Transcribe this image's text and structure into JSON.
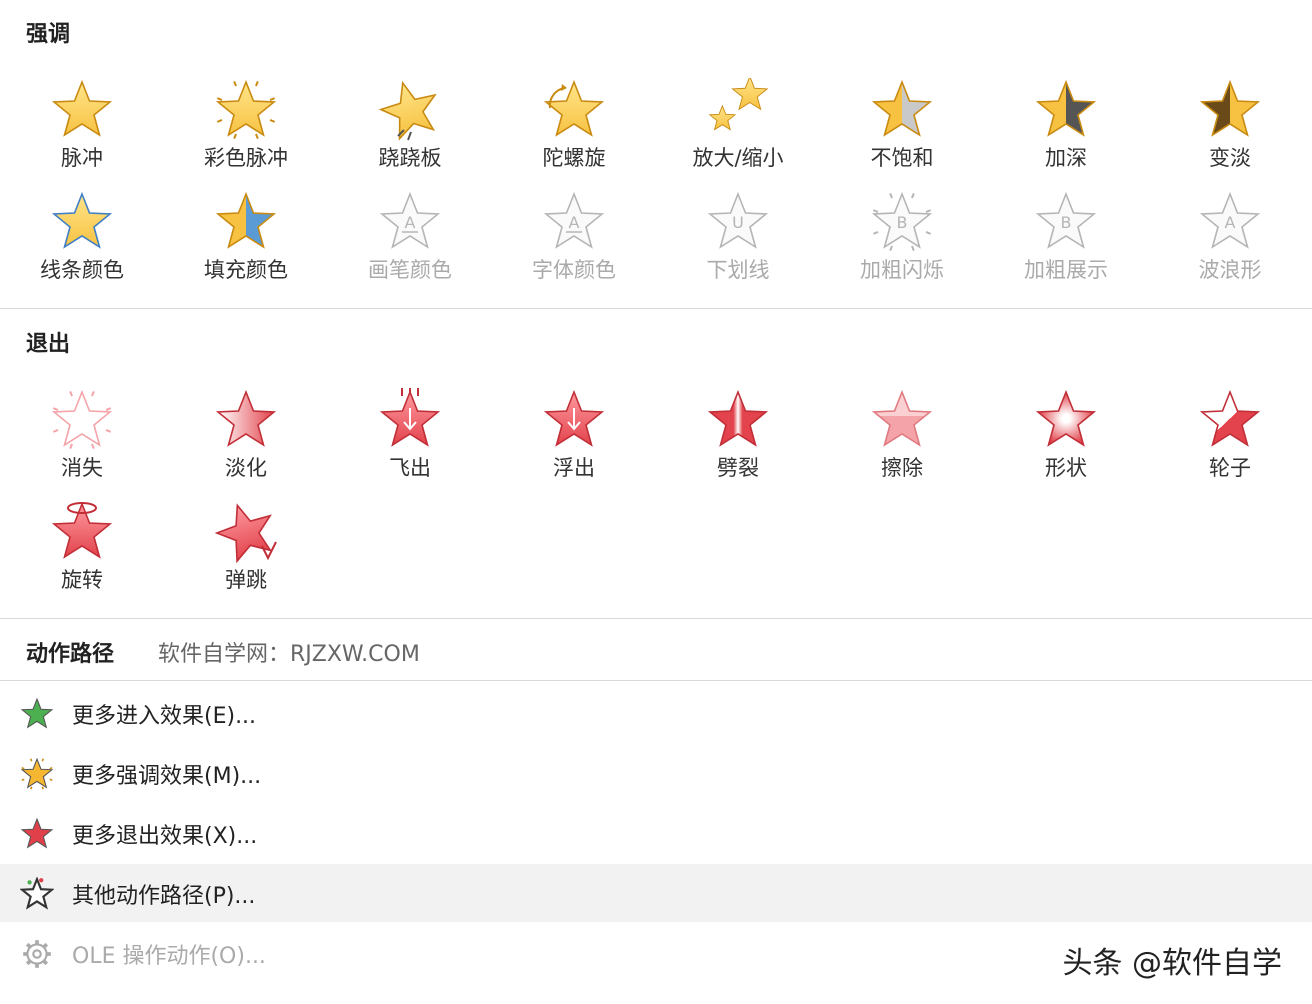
{
  "emphasis": {
    "title": "强调",
    "rows": [
      [
        {
          "label": "脉冲",
          "icon": "pulse-star-icon",
          "style": "gold",
          "disabled": false
        },
        {
          "label": "彩色脉冲",
          "icon": "color-pulse-star-icon",
          "style": "gold-burst",
          "disabled": false
        },
        {
          "label": "跷跷板",
          "icon": "teeter-star-icon",
          "style": "gold-tilt",
          "disabled": false
        },
        {
          "label": "陀螺旋",
          "icon": "spin-star-icon",
          "style": "gold-spin",
          "disabled": false
        },
        {
          "label": "放大/缩小",
          "icon": "grow-shrink-star-icon",
          "style": "gold-double",
          "disabled": false
        },
        {
          "label": "不饱和",
          "icon": "desaturate-star-icon",
          "style": "gold-gray",
          "disabled": false
        },
        {
          "label": "加深",
          "icon": "darken-star-icon",
          "style": "gold-dark",
          "disabled": false
        },
        {
          "label": "变淡",
          "icon": "lighten-star-icon",
          "style": "gold-brown",
          "disabled": false
        }
      ],
      [
        {
          "label": "线条颜色",
          "icon": "line-color-star-icon",
          "style": "gold-blueline",
          "disabled": false
        },
        {
          "label": "填充颜色",
          "icon": "fill-color-star-icon",
          "style": "gold-bluefill",
          "disabled": false
        },
        {
          "label": "画笔颜色",
          "icon": "brush-color-star-icon",
          "style": "outline-A",
          "disabled": true
        },
        {
          "label": "字体颜色",
          "icon": "font-color-star-icon",
          "style": "outline-A",
          "disabled": true
        },
        {
          "label": "下划线",
          "icon": "underline-star-icon",
          "style": "outline-U",
          "disabled": true
        },
        {
          "label": "加粗闪烁",
          "icon": "bold-flash-star-icon",
          "style": "outline-B-burst",
          "disabled": true
        },
        {
          "label": "加粗展示",
          "icon": "bold-reveal-star-icon",
          "style": "outline-B",
          "disabled": true
        },
        {
          "label": "波浪形",
          "icon": "wave-star-icon",
          "style": "outline-A-wave",
          "disabled": true
        }
      ]
    ]
  },
  "exit": {
    "title": "退出",
    "rows": [
      [
        {
          "label": "消失",
          "icon": "disappear-star-icon",
          "style": "red-outline-burst",
          "disabled": false
        },
        {
          "label": "淡化",
          "icon": "fade-star-icon",
          "style": "red-fade",
          "disabled": false
        },
        {
          "label": "飞出",
          "icon": "fly-out-star-icon",
          "style": "red-arrow-lines",
          "disabled": false
        },
        {
          "label": "浮出",
          "icon": "float-out-star-icon",
          "style": "red-arrow",
          "disabled": false
        },
        {
          "label": "劈裂",
          "icon": "split-star-icon",
          "style": "red-split",
          "disabled": false
        },
        {
          "label": "擦除",
          "icon": "wipe-star-icon",
          "style": "red-wipe",
          "disabled": false
        },
        {
          "label": "形状",
          "icon": "shape-star-icon",
          "style": "red-glow",
          "disabled": false
        },
        {
          "label": "轮子",
          "icon": "wheel-star-icon",
          "style": "red-wheel",
          "disabled": false
        }
      ],
      [
        {
          "label": "旋转",
          "icon": "rotate-star-icon",
          "style": "red-rotate",
          "disabled": false
        },
        {
          "label": "弹跳",
          "icon": "bounce-star-icon",
          "style": "red-bounce",
          "disabled": false
        }
      ]
    ]
  },
  "motion_path": {
    "title": "动作路径",
    "note": "软件自学网：RJZXW.COM"
  },
  "menu": [
    {
      "label": "更多进入效果(E)...",
      "icon": "green-star-icon",
      "color": "#4caf50",
      "disabled": false,
      "hover": false
    },
    {
      "label": "更多强调效果(M)...",
      "icon": "gold-burst-star-icon",
      "color": "#f5b731",
      "disabled": false,
      "hover": false
    },
    {
      "label": "更多退出效果(X)...",
      "icon": "red-star-icon",
      "color": "#e0404a",
      "disabled": false,
      "hover": false
    },
    {
      "label": "其他动作路径(P)...",
      "icon": "outline-path-star-icon",
      "color": "#333333",
      "disabled": false,
      "hover": true
    },
    {
      "label": "OLE 操作动作(O)...",
      "icon": "gear-icon",
      "color": "#aaaaaa",
      "disabled": true,
      "hover": false
    }
  ],
  "watermark": "头条 @软件自学",
  "colors": {
    "gold": "#f7c242",
    "gold_dark": "#c98a12",
    "red": "#e2434c",
    "red_light": "#f4a3a8",
    "disabled": "#aaaaaa"
  }
}
